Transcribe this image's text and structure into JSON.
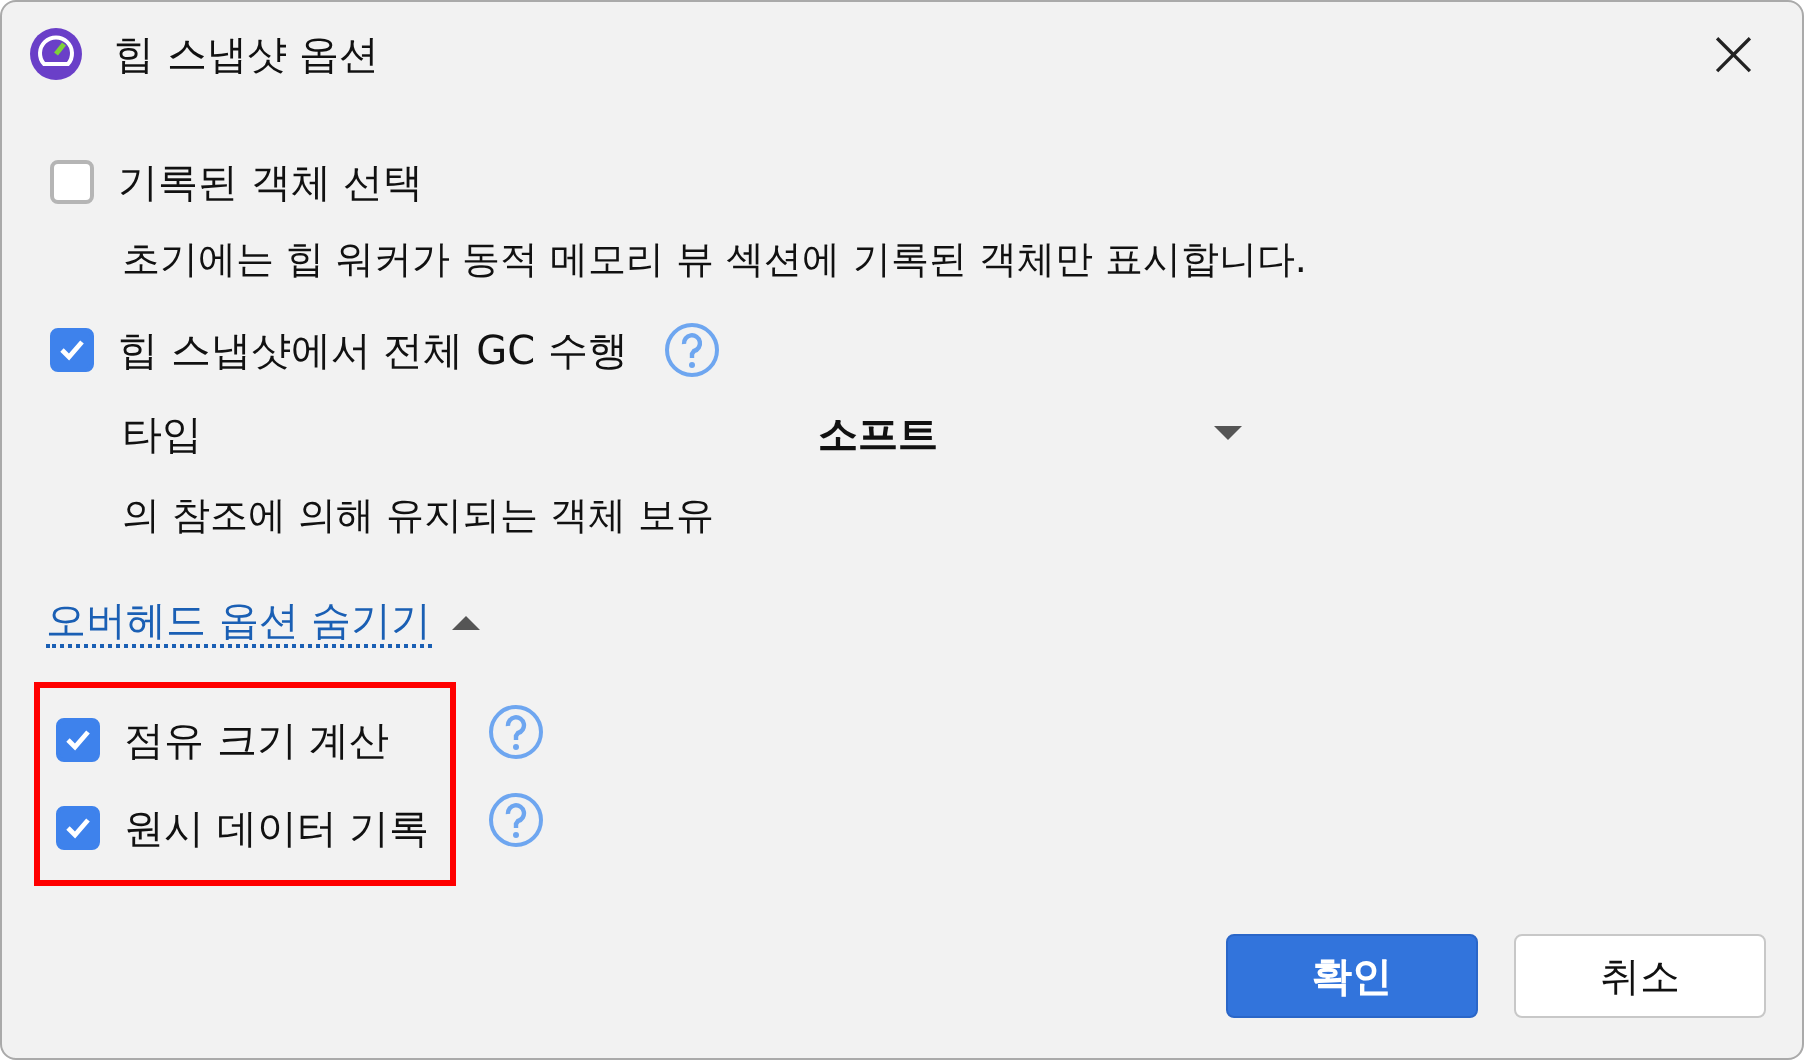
{
  "window": {
    "title": "힙 스냅샷 옵션",
    "close": "×"
  },
  "options": [
    {
      "label": "기록된 객체 선택",
      "checked": false,
      "description": "초기에는 힙 워커가 동적 메모리 뷰 섹션에 기록된 객체만 표시합니다."
    },
    {
      "label": "힙 스냅샷에서 전체 GC 수행",
      "checked": true,
      "help": true
    }
  ],
  "gc_type": {
    "label": "타입",
    "value": "소프트",
    "note": "의 참조에 의해 유지되는 객체 보유"
  },
  "overhead_toggle": {
    "label": "오버헤드 옵션 숨기기",
    "expanded": true
  },
  "overhead_options": {
    "highlighted": true,
    "items": [
      {
        "label": "점유 크기 계산",
        "checked": true,
        "help": true
      },
      {
        "label": "원시 데이터 기록",
        "checked": true,
        "help": true
      }
    ]
  },
  "buttons": [
    {
      "label": "확인",
      "kind": "primary"
    },
    {
      "label": "취소",
      "kind": "secondary"
    }
  ]
}
